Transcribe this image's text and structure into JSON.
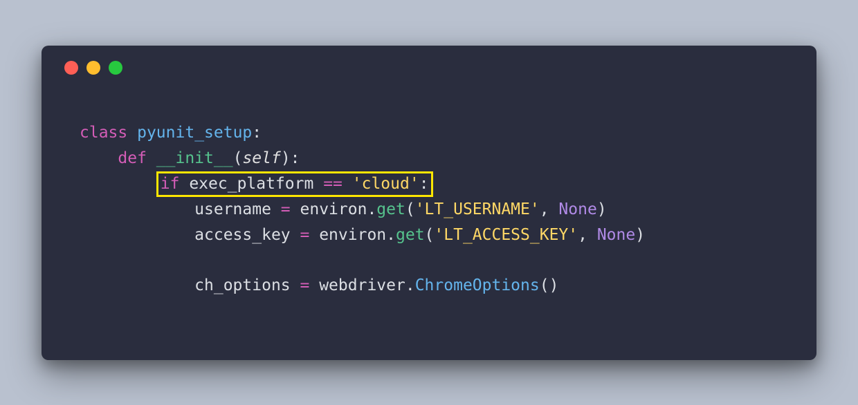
{
  "l1": {
    "class_kw": "class",
    "class_name": "pyunit_setup",
    "colon": ":"
  },
  "l2": {
    "indent": "    ",
    "def_kw": "def",
    "func_name": "__init__",
    "open": "(",
    "self": "self",
    "close": "):"
  },
  "l3": {
    "indent": "        ",
    "if_kw": "if",
    "var": " exec_platform ",
    "eq": "==",
    "str": " 'cloud'",
    "colon": ":"
  },
  "l4": {
    "indent": "            ",
    "var": "username ",
    "eq": "=",
    "obj": " environ",
    "dot": ".",
    "method": "get",
    "open": "(",
    "str": "'LT_USERNAME'",
    "comma": ", ",
    "none": "None",
    "close": ")"
  },
  "l5": {
    "indent": "            ",
    "var": "access_key ",
    "eq": "=",
    "obj": " environ",
    "dot": ".",
    "method": "get",
    "open": "(",
    "str": "'LT_ACCESS_KEY'",
    "comma": ", ",
    "none": "None",
    "close": ")"
  },
  "l6": {
    "indent": "            ",
    "var": "ch_options ",
    "eq": "=",
    "obj": " webdriver",
    "dot": ".",
    "class": "ChromeOptions",
    "parens": "()"
  }
}
